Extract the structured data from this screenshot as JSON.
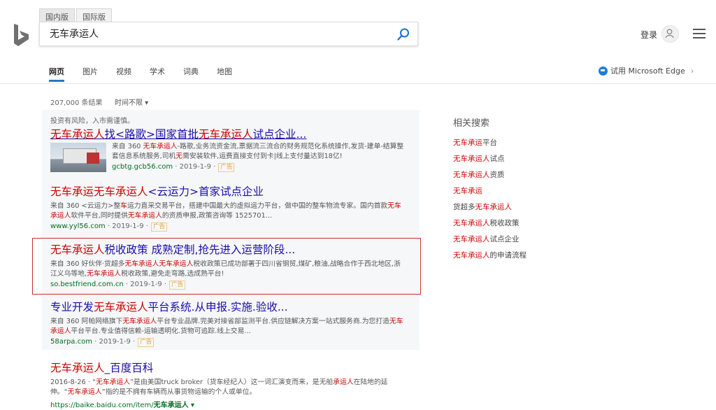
{
  "header": {
    "scope_tabs": [
      "国内版",
      "国际版"
    ],
    "search_value": "无车承运人",
    "login_label": "登录"
  },
  "nav": {
    "items": [
      "网页",
      "图片",
      "视频",
      "学术",
      "词典",
      "地图"
    ],
    "edge_label": "试用 Microsoft Edge"
  },
  "toolbar": {
    "result_count": "207,000 条结果",
    "time_filter": "时间不限 ▾"
  },
  "ad_notice": "投资有风险，入市需谨慎。",
  "results": [
    {
      "title_pre": "",
      "title_hl1": "无车承运人",
      "title_mid": "找<路歌>国家首批",
      "title_hl2": "无车承运人",
      "title_post": "试点企业...",
      "snip_a": "来自 360 ",
      "snip_hl1": "无车承运人",
      "snip_b": "-路歌,业务流资金流,票据流三流合的财务规范化系统操作,发货-建单-结算整套信息系统服务,司机",
      "snip_hl2": "无",
      "snip_c": "需安装软件,运费直接支付到卡|线上支付量达到18亿!",
      "url": "gcbtg.gcb56.com",
      "date": "· 2019-1-9 ·",
      "ad": "广告"
    },
    {
      "title_pre": "",
      "title_hl1": "无车承运",
      "title_mid": "无车承运人",
      "title_hl2": "",
      "title_post": "<云运力>首家试点企业",
      "snip_a": "来自 360 <云运力>整",
      "snip_hl1": "车",
      "snip_b": "运力直采交易平台，搭建中国最大的虚拟运力平台，做中国的整车物流专家。国内首款",
      "snip_hl2": "无车承运人",
      "snip_c": "软件平台,同时提供",
      "snip_hl3": "无车承运人",
      "snip_d": "的资质申报,政策咨询等 1525701...",
      "url": "www.yyl56.com",
      "date": "· 2019-1-9 ·",
      "ad": "广告"
    },
    {
      "title_pre": "",
      "title_hl1": "无车承运人",
      "title_mid": "税收政策 成熟定制,抢先进入运营阶段...",
      "title_hl2": "",
      "title_post": "",
      "snip_a": "来自 360 好伙伴·货超多",
      "snip_hl1": "无车承运人无车承运人",
      "snip_b": "税收政策已成功部署于四川省钢贸,煤矿,粮油,战略合作于西北地区,浙江义乌等地,",
      "snip_hl2": "无车承运人",
      "snip_c": "税收政策,避免走弯路,选成熟平台!",
      "url": "so.bestfriend.com.cn",
      "date": "· 2019-1-9 ·",
      "ad": "广告"
    },
    {
      "title_pre": "专业开发",
      "title_hl1": "无车承运人",
      "title_mid": "平台系统.从申报.实施.验收...",
      "title_hl2": "",
      "title_post": "",
      "snip_a": "来自 360 阿帕网络旗下",
      "snip_hl1": "无车承运人",
      "snip_b": "平台专业品牌.完美对接省部监测平台.供应链解决方案一站式服务商.为您打造",
      "snip_hl2": "无车承运人",
      "snip_c": "平台平台.专业值得信赖-运输透明化.货物可追踪.线上交易...",
      "url": "58arpa.com",
      "date": "· 2019-1-9 ·",
      "ad": "广告"
    },
    {
      "title_pre": "",
      "title_hl1": "无车承运人",
      "title_mid": "_百度百科",
      "title_hl2": "",
      "title_post": "",
      "snip_a": "2016-8-26 · “",
      "snip_hl1": "无车承运人",
      "snip_b": "”是由美国truck broker（货车经纪人）这一词汇演变而来，是无船",
      "snip_hl2": "承运人",
      "snip_c": "在陆地的延伸。“",
      "snip_hl3": "无车承运人",
      "snip_d": "”指的是不拥有车辆而从事货物运输的个人或单位。",
      "url": "https://baike.baidu.com/item/",
      "url_bold": "无车承运人",
      "url_arrow": " ▾"
    }
  ],
  "related": {
    "title": "相关搜索",
    "items": [
      {
        "hl": "无车承运",
        "plain": "平台"
      },
      {
        "hl": "无车承运人",
        "plain": "试点"
      },
      {
        "hl": "无车承运人",
        "plain": "资质"
      },
      {
        "hl": "无车承运",
        "plain": ""
      },
      {
        "pre": "货超多",
        "hl": "无车承运人",
        "plain": ""
      },
      {
        "hl": "无车承运人",
        "plain": "税收政策"
      },
      {
        "hl": "无车承运人",
        "plain": "试点企业"
      },
      {
        "hl": "无车承运人",
        "plain": "的申请流程"
      }
    ]
  },
  "colors": {
    "link": "#1a0dab",
    "highlight": "#cc0000",
    "url_green": "#006d21",
    "accent_blue": "#1e7bc9",
    "frame_red": "#c9302c"
  },
  "icons": [
    "bing-logo-icon",
    "search-icon",
    "user-icon",
    "menu-icon",
    "edge-icon",
    "chevron-right-icon"
  ]
}
